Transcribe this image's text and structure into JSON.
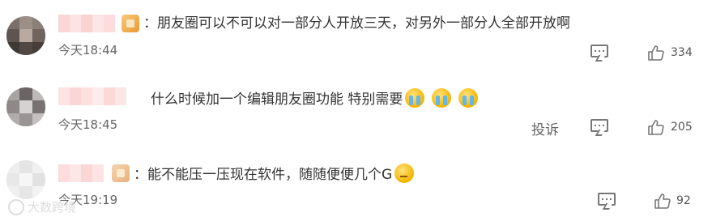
{
  "comments": [
    {
      "text": "：朋友圈可以不可以对一部分人开放三天，对另外一部分人全部开放啊",
      "time": "今天18:44",
      "likes": "334",
      "report": ""
    },
    {
      "text": "什么时候加一个编辑朋友圈功能 特别需要",
      "time": "今天18:45",
      "likes": "205",
      "report": "投诉"
    },
    {
      "text": "：能不能压一压现在软件，随随便便几个G",
      "time": "今天19:19",
      "likes": "92",
      "report": ""
    }
  ],
  "watermark": "大数跨境",
  "colors": {
    "name_blur": "#fbdada",
    "text": "#333333",
    "meta": "#666666"
  },
  "icons": [
    "reply-icon",
    "thumbs-up-icon",
    "crying-emoji-icon",
    "thinking-emoji-icon"
  ]
}
